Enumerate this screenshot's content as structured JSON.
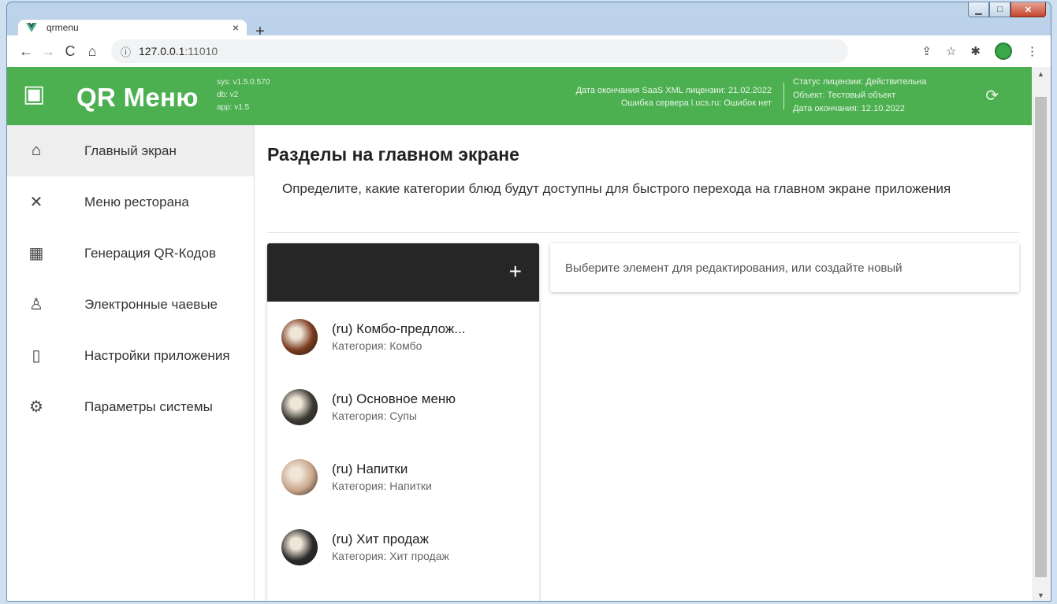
{
  "window": {
    "minimize_glyph": "▁",
    "maximize_glyph": "□",
    "close_glyph": "✕"
  },
  "browser": {
    "tab_title": "qrmenu",
    "tab_close": "×",
    "new_tab": "+",
    "back": "←",
    "forward": "→",
    "reload": "C",
    "home": "⌂",
    "info_icon": "ⓘ",
    "url_host": "127.0.0.1",
    "url_port": ":11010",
    "share_icon": "⇪",
    "star_icon": "☆",
    "extensions_icon": "✱",
    "menu_icon": "⋮"
  },
  "header": {
    "brand_icon": "▣",
    "brand": "QR Меню",
    "versions": [
      "sys: v1.5.0.570",
      "db: v2",
      "app: v1.5"
    ],
    "license_left": [
      "Дата окончания SaaS XML лицензии: 21.02.2022",
      "Ошибка сервера l.ucs.ru: Ошибок нет"
    ],
    "license_right": [
      "Статус лицензии: Действительна",
      "Объект: Тестовый объект",
      "Дата окончания: 12.10.2022"
    ],
    "refresh_icon": "⟳"
  },
  "sidebar": {
    "items": [
      {
        "icon": "⌂",
        "label": "Главный экран"
      },
      {
        "icon": "✕",
        "label": "Меню ресторана"
      },
      {
        "icon": "▦",
        "label": "Генерация QR-Кодов"
      },
      {
        "icon": "♙",
        "label": "Электронные чаевые"
      },
      {
        "icon": "▯",
        "label": "Настройки приложения"
      },
      {
        "icon": "⚙",
        "label": "Параметры системы"
      }
    ]
  },
  "main": {
    "title": "Разделы на главном экране",
    "description": "Определите, какие категории блюд будут доступны для быстрого перехода на главном экране приложения",
    "add_icon": "+",
    "editor_placeholder": "Выберите элемент для редактирования, или создайте новый",
    "sections": [
      {
        "title": "(ru) Комбо-предлож...",
        "subtitle": "Категория: Комбо",
        "color": "#7a3b1e"
      },
      {
        "title": "(ru) Основное меню",
        "subtitle": "Категория: Супы",
        "color": "#3b3a33"
      },
      {
        "title": "(ru) Напитки",
        "subtitle": "Категория: Напитки",
        "color": "#c9a58a"
      },
      {
        "title": "(ru) Хит продаж",
        "subtitle": "Категория: Хит продаж",
        "color": "#2a2a2a"
      }
    ]
  },
  "colors": {
    "accent": "#4caf50",
    "list_header": "#262626"
  }
}
